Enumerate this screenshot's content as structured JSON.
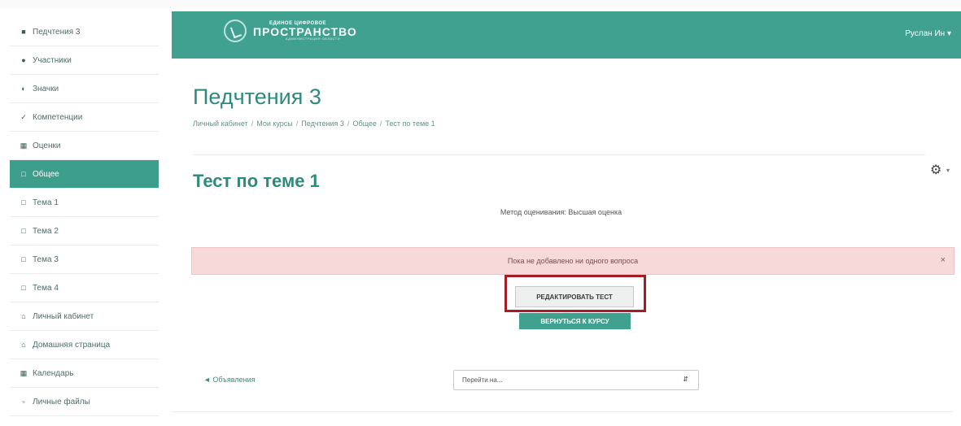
{
  "sidebar": {
    "items": [
      {
        "icon": "graduation-cap-icon",
        "label": "Педчтения 3"
      },
      {
        "icon": "users-icon",
        "label": "Участники"
      },
      {
        "icon": "badge-icon",
        "label": "Значки"
      },
      {
        "icon": "check-icon",
        "label": "Компетенции"
      },
      {
        "icon": "grades-icon",
        "label": "Оценки"
      },
      {
        "icon": "folder-icon",
        "label": "Общее"
      },
      {
        "icon": "folder-icon",
        "label": "Тема 1"
      },
      {
        "icon": "folder-icon",
        "label": "Тема 2"
      },
      {
        "icon": "folder-icon",
        "label": "Тема 3"
      },
      {
        "icon": "folder-icon",
        "label": "Тема 4"
      },
      {
        "icon": "home-icon",
        "label": "Личный кабинет"
      },
      {
        "icon": "home-icon",
        "label": "Домашняя страница"
      },
      {
        "icon": "calendar-icon",
        "label": "Календарь"
      },
      {
        "icon": "file-icon",
        "label": "Личные файлы"
      }
    ],
    "active_index": 5
  },
  "header": {
    "logo_small": "ЕДИНОЕ ЦИФРОВОЕ",
    "logo_big": "ПРОСТРАНСТВО",
    "logo_tiny": "АДМИНИСТРАЦИЯ ОБЛАСТИ",
    "user": "Руслан Ин"
  },
  "page": {
    "title": "Педчтения 3",
    "breadcrumb": [
      "Личный кабинет",
      "Мои курсы",
      "Педчтения 3",
      "Общее",
      "Тест по теме 1"
    ]
  },
  "quiz": {
    "title": "Тест по теме 1",
    "grading_method": "Метод оценивания: Высшая оценка",
    "alert": "Пока не добавлено ни одного вопроса",
    "alert_close": "×",
    "edit_button": "РЕДАКТИРОВАТЬ ТЕСТ",
    "back_button": "ВЕРНУТЬСЯ К КУРСУ"
  },
  "footer_nav": {
    "prev_link": "◄ Объявления",
    "jump_select": "Перейти на..."
  },
  "colors": {
    "brand": "#40a190",
    "highlight": "#a31c26",
    "alert_bg": "#f7d9d9"
  }
}
